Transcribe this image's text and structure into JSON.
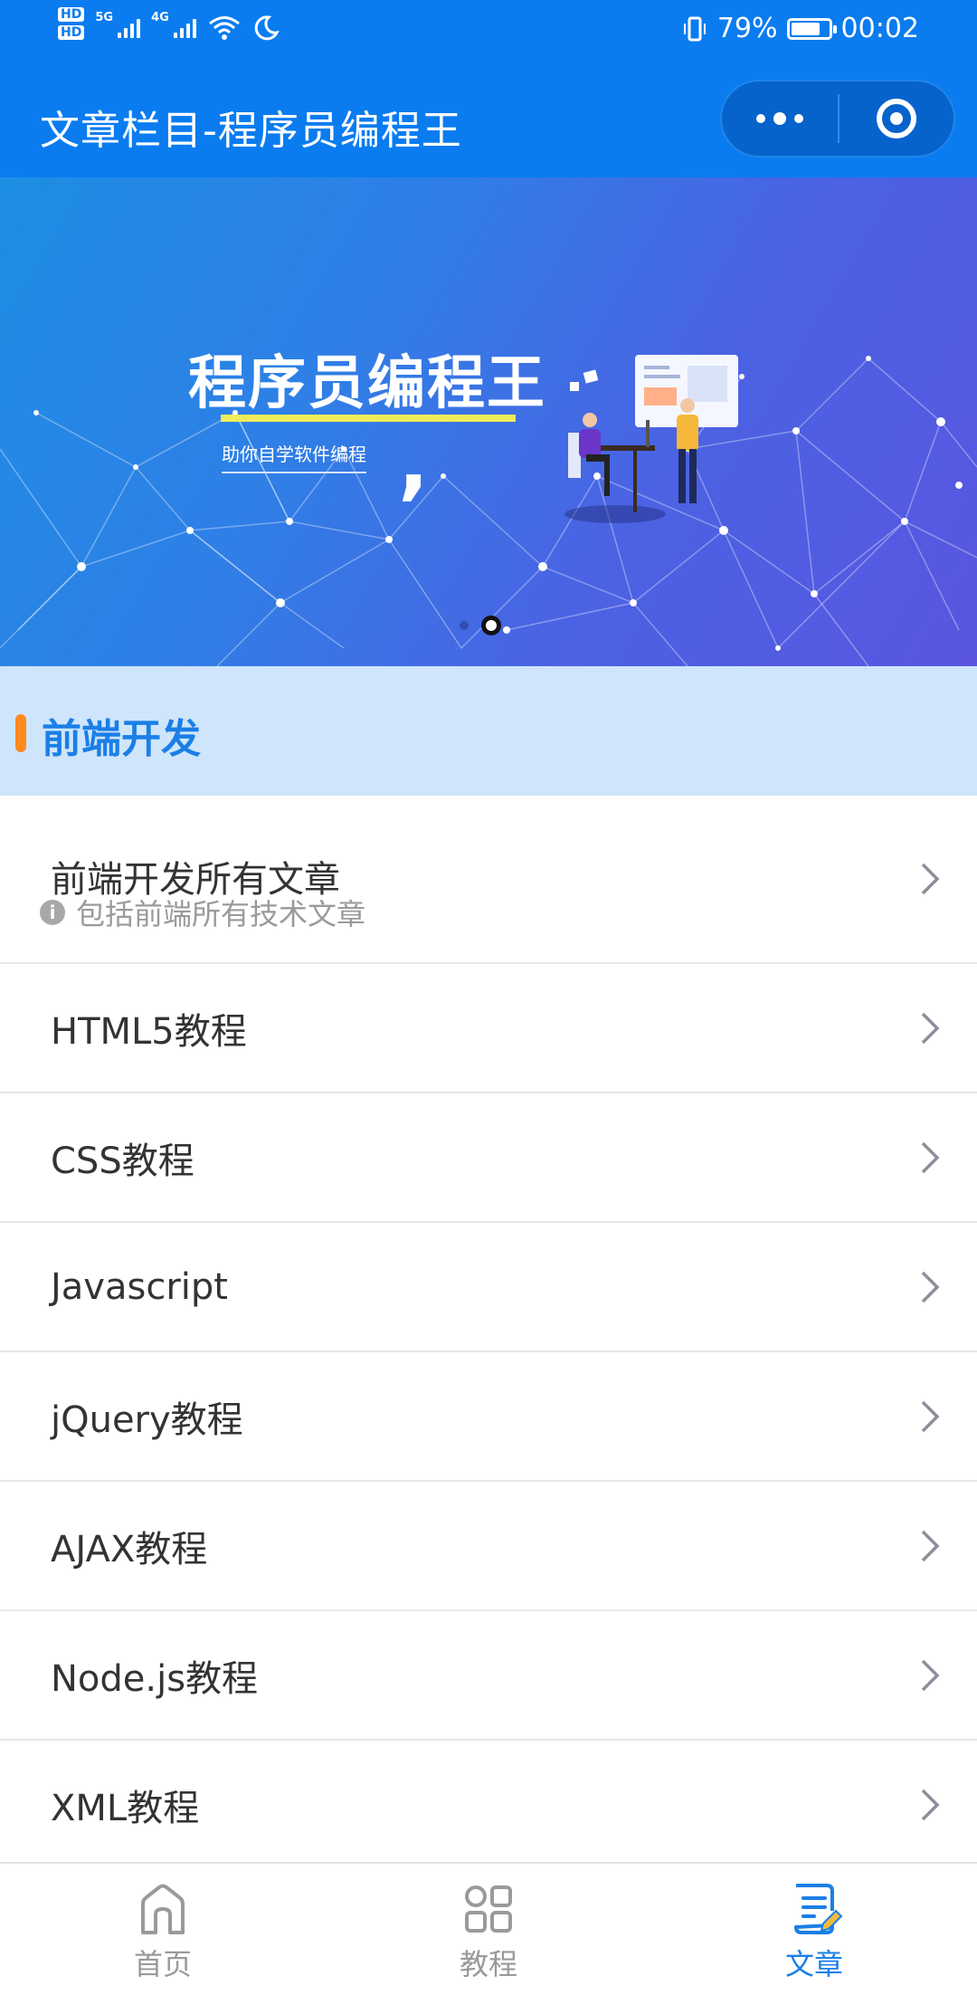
{
  "status": {
    "hd_badges": [
      "HD",
      "HD"
    ],
    "network_labels": [
      "5G",
      "4G"
    ],
    "battery_percent": "79%",
    "battery_level": 0.79,
    "time": "00:02"
  },
  "header": {
    "title": "文章栏目-程序员编程王",
    "menu_icon": "more-dots-icon",
    "close_icon": "target-circle-icon"
  },
  "banner": {
    "title": "程序员编程王",
    "subtitle": "助你自学软件编程",
    "slide_count": 2,
    "active_slide": 2
  },
  "section": {
    "label": "前端开发",
    "accent_color": "#ff8a1e"
  },
  "list": {
    "first": {
      "title": "前端开发所有文章",
      "description": "包括前端所有技术文章",
      "info_icon": "i"
    },
    "items": [
      {
        "label": "HTML5教程"
      },
      {
        "label": "CSS教程"
      },
      {
        "label": "Javascript"
      },
      {
        "label": "jQuery教程"
      },
      {
        "label": "AJAX教程"
      },
      {
        "label": "Node.js教程"
      },
      {
        "label": "XML教程"
      }
    ]
  },
  "tabbar": {
    "tabs": [
      {
        "label": "首页",
        "icon": "home-icon",
        "active": false
      },
      {
        "label": "教程",
        "icon": "grid-icon",
        "active": false
      },
      {
        "label": "文章",
        "icon": "article-icon",
        "active": true
      }
    ],
    "active_color": "#1a7fe6",
    "inactive_color": "#9a9a9a"
  }
}
